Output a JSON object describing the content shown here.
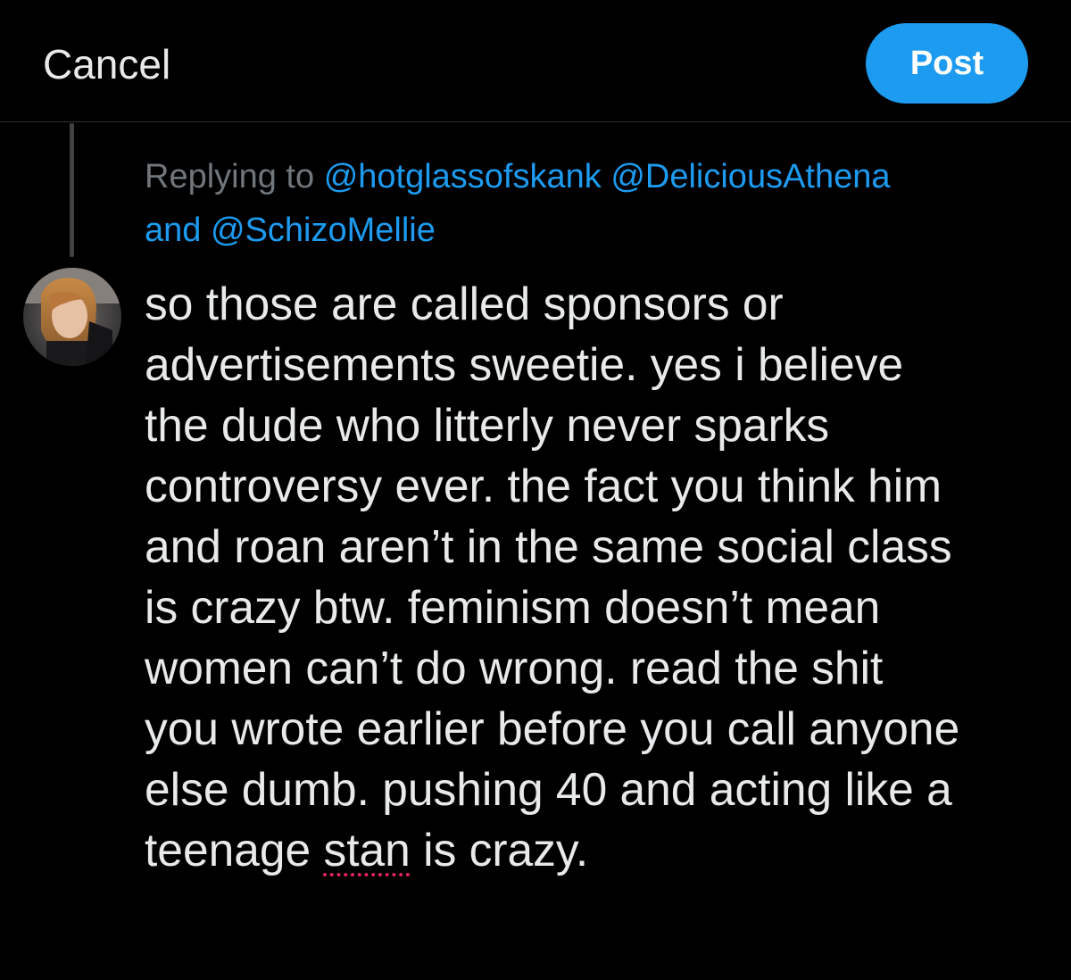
{
  "header": {
    "cancel_label": "Cancel",
    "post_label": "Post"
  },
  "reply": {
    "prefix": "Replying to",
    "mention_1": "@hotglassofskank",
    "mention_2": "@DeliciousAthena",
    "and_word": "and",
    "mention_3": "@SchizoMellie"
  },
  "tweet": {
    "line_1": "so those are called sponsors or",
    "line_2": "advertisements sweetie. yes i believe",
    "line_3": "the dude who litterly never sparks",
    "line_4": "controversy ever. the fact you think him",
    "line_5": "and roan aren’t in the same social class",
    "line_6": "is crazy btw. feminism doesn’t mean",
    "line_7": "women can’t do wrong. read the shit",
    "line_8": "you wrote earlier before you call anyone",
    "line_9": "else dumb. pushing 40 and acting like a",
    "line_10_before": "teenage",
    "line_10_flagged": "stan",
    "line_10_after": "is crazy."
  },
  "colors": {
    "background": "#000000",
    "accent": "#1d9bf0",
    "text": "#e7e9ea",
    "muted": "#71767b",
    "spellcheck": "#e0245e"
  },
  "icons": {
    "avatar": "user-avatar-photo"
  }
}
